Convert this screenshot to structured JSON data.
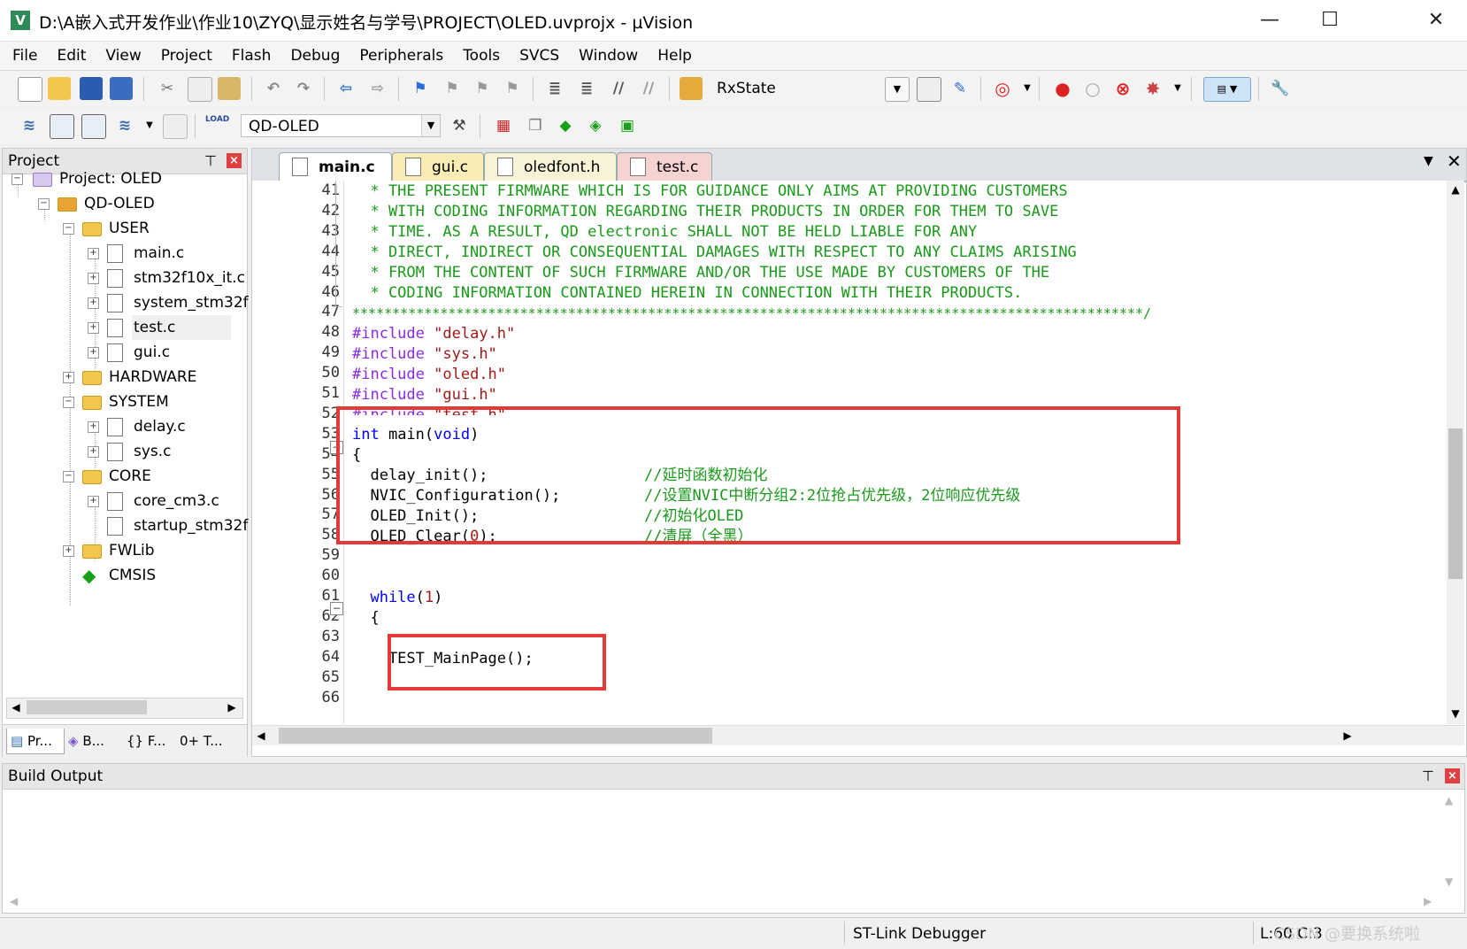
{
  "window": {
    "title": "D:\\A嵌入式开发作业\\作业10\\ZYQ\\显示姓名与学号\\PROJECT\\OLED.uvprojx - µVision",
    "icon": "uvision-logo-icon",
    "minimize": "—",
    "maximize": "☐",
    "close": "✕"
  },
  "menu": [
    "File",
    "Edit",
    "View",
    "Project",
    "Flash",
    "Debug",
    "Peripherals",
    "Tools",
    "SVCS",
    "Window",
    "Help"
  ],
  "toolbar1": {
    "search_combo": "RxState"
  },
  "toolbar2": {
    "target_combo": "QD-OLED",
    "load_label": "LOAD"
  },
  "project_pane": {
    "title": "Project",
    "tree": [
      {
        "label": "Project: OLED"
      },
      {
        "label": "QD-OLED"
      },
      {
        "label": "USER"
      },
      {
        "label": "main.c"
      },
      {
        "label": "stm32f10x_it.c"
      },
      {
        "label": "system_stm32f"
      },
      {
        "label": "test.c"
      },
      {
        "label": "gui.c"
      },
      {
        "label": "HARDWARE"
      },
      {
        "label": "SYSTEM"
      },
      {
        "label": "delay.c"
      },
      {
        "label": "sys.c"
      },
      {
        "label": "CORE"
      },
      {
        "label": "core_cm3.c"
      },
      {
        "label": "startup_stm32f"
      },
      {
        "label": "FWLib"
      },
      {
        "label": "CMSIS"
      }
    ],
    "bottom_tabs": [
      "Pr...",
      "B...",
      "{} F...",
      "0+ T..."
    ]
  },
  "editor": {
    "tabs": [
      "main.c",
      "gui.c",
      "oledfont.h",
      "test.c"
    ],
    "line_numbers": [
      "41",
      "42",
      "43",
      "44",
      "45",
      "46",
      "47",
      "48",
      "49",
      "50",
      "51",
      "52",
      "53",
      "54",
      "55",
      "56",
      "57",
      "58",
      "59",
      "60",
      "61",
      "62",
      "63",
      "64",
      "65",
      "66"
    ],
    "lines": {
      "l41": "  * THE PRESENT FIRMWARE WHICH IS FOR GUIDANCE ONLY AIMS AT PROVIDING CUSTOMERS",
      "l42": "  * WITH CODING INFORMATION REGARDING THEIR PRODUCTS IN ORDER FOR THEM TO SAVE",
      "l43": "  * TIME. AS A RESULT, QD electronic SHALL NOT BE HELD LIABLE FOR ANY",
      "l44": "  * DIRECT, INDIRECT OR CONSEQUENTIAL DAMAGES WITH RESPECT TO ANY CLAIMS ARISING",
      "l45": "  * FROM THE CONTENT OF SUCH FIRMWARE AND/OR THE USE MADE BY CUSTOMERS OF THE",
      "l46": "  * CODING INFORMATION CONTAINED HEREIN IN CONNECTION WITH THEIR PRODUCTS.",
      "l47": "***************************************************************************************************/",
      "include_kw": "#include",
      "inc48": "\"delay.h\"",
      "inc49": "\"sys.h\"",
      "inc50": "\"oled.h\"",
      "inc51": "\"gui.h\"",
      "inc52": "\"test.h\"",
      "l53_kw1": "int",
      "l53_mid": " main(",
      "l53_kw2": "void",
      "l53_end": ")",
      "l54": "{",
      "l55_code": "  delay_init();",
      "l55_cmt": "//延时函数初始化",
      "l56_code": "  NVIC_Configuration();",
      "l56_cmt": "//设置NVIC中断分组2:2位抢占优先级，2位响应优先级",
      "l57_code": "  OLED_Init();",
      "l57_cmt": "//初始化OLED",
      "l58_code_a": "  OLED_Clear(",
      "l58_num": "0",
      "l58_code_b": ");",
      "l58_cmt": "//清屏（全黑）",
      "l61_kw": "  while",
      "l61_a": "(",
      "l61_num": "1",
      "l61_b": ")",
      "l62": "  {",
      "l64": "    TEST_MainPage();"
    }
  },
  "build_output": {
    "title": "Build Output"
  },
  "status": {
    "debugger": "ST-Link Debugger",
    "position": "L:60 C:3",
    "watermark": "CSDN @要换系统啦"
  },
  "colors": {
    "comment": "#1a9a1a",
    "keyword": "#0000ff",
    "preprocessor": "#8a2be2",
    "string": "#a11a1a",
    "highlight_box": "#e53935"
  }
}
